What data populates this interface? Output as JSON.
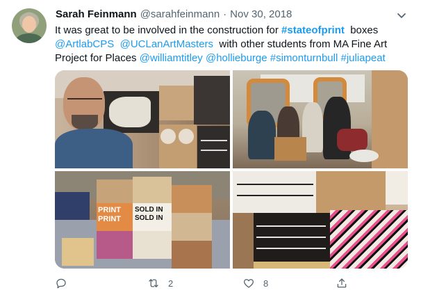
{
  "tweet": {
    "display_name": "Sarah Feinmann",
    "handle": "@sarahfeinmann",
    "separator": "·",
    "date": "Nov 30, 2018",
    "text_lines": [
      [
        "It was great to be involved in the construction for ",
        "#stateofprint",
        "  boxes"
      ],
      [
        "@ArtlabCPS",
        "  ",
        "@UCLanArtMasters",
        "  with other students from MA Fine Art"
      ],
      [
        "Project for Places ",
        "@williamtitley",
        " ",
        "@hollieburge",
        " ",
        "#simonturnbull",
        " ",
        "#juliapeat"
      ]
    ],
    "link_color": "#1d9bf0",
    "photos": [
      "photo-man-with-boxes",
      "photo-people-assembling",
      "photo-box-stacks",
      "photo-printed-boxes"
    ],
    "actions": {
      "reply_icon": "reply-icon",
      "retweet_icon": "retweet-icon",
      "retweet_count": "2",
      "like_icon": "heart-icon",
      "like_count": "8",
      "share_icon": "share-icon"
    },
    "printed_box_text": {
      "box_print_1": "PRINT",
      "box_print_2": "PRINT",
      "box_sold": "SOLD IN",
      "box_sold2": "SOLD IN"
    }
  }
}
